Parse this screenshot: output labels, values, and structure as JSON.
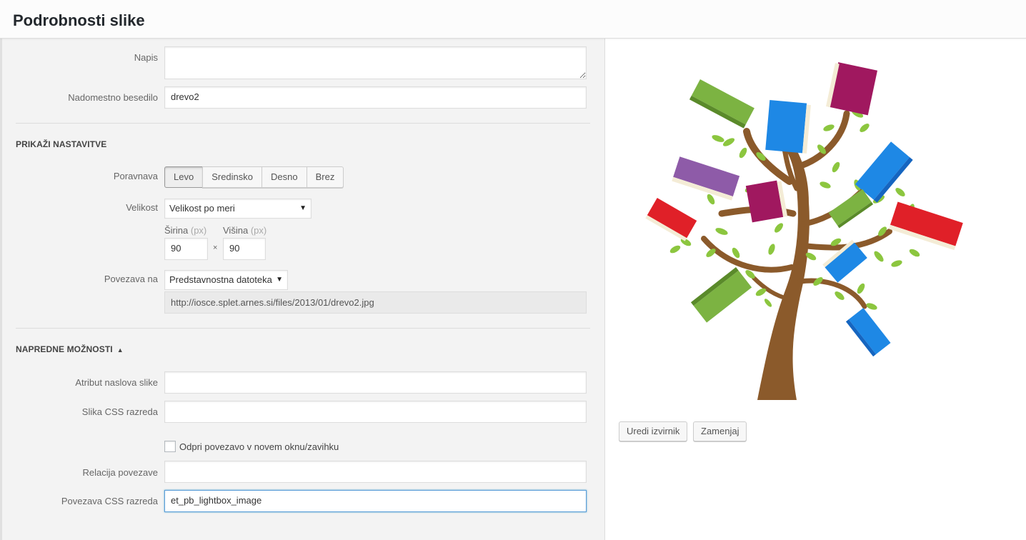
{
  "header": {
    "title": "Podrobnosti slike"
  },
  "caption": {
    "label": "Napis",
    "value": ""
  },
  "alt_text": {
    "label": "Nadomestno besedilo",
    "value": "drevo2"
  },
  "display_settings": {
    "section_title": "PRIKAŽI NASTAVITVE",
    "align_label": "Poravnava",
    "align_options": [
      "Levo",
      "Sredinsko",
      "Desno",
      "Brez"
    ],
    "align_selected": "Levo",
    "size_label": "Velikost",
    "size_value": "Velikost po meri",
    "width_label": "Širina",
    "height_label": "Višina",
    "unit": "(px)",
    "width_value": "90",
    "height_value": "90",
    "times": "×",
    "link_label": "Povezava na",
    "link_value": "Predstavnostna datoteka",
    "link_url": "http://iosce.splet.arnes.si/files/2013/01/drevo2.jpg"
  },
  "advanced": {
    "section_title": "NAPREDNE MOŽNOSTI",
    "toggle_icon": "▲",
    "title_attr_label": "Atribut naslova slike",
    "title_attr_value": "",
    "css_class_label": "Slika CSS razreda",
    "css_class_value": "",
    "new_tab_label": "Odpri povezavo v novem oknu/zavihku",
    "new_tab_checked": false,
    "rel_label": "Relacija povezave",
    "rel_value": "",
    "link_css_label": "Povezava CSS razreda",
    "link_css_value": "et_pb_lightbox_image"
  },
  "preview": {
    "image_name": "book-tree-illustration",
    "edit_button": "Uredi izvirnik",
    "replace_button": "Zamenjaj"
  },
  "colors": {
    "book_green": "#7cb342",
    "book_blue": "#1e88e5",
    "book_magenta": "#a0185f",
    "book_purple": "#8e5ba8",
    "book_red": "#e02028",
    "leaf_green": "#8cc63f",
    "trunk_brown": "#8b5a2b",
    "focus_border": "#5b9dd9"
  }
}
